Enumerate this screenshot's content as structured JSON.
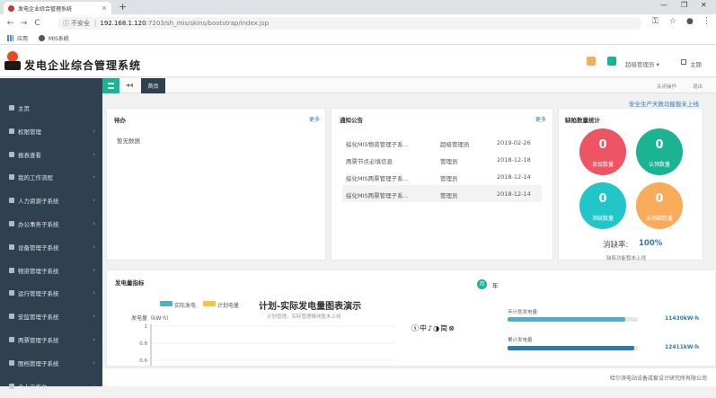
{
  "browser": {
    "tab_title": "发电企业综合管理系统",
    "tab_close": "×",
    "new_tab": "+",
    "win_min": "—",
    "win_max": "❐",
    "win_close": "✕",
    "back": "←",
    "forward": "→",
    "reload": "C",
    "info_icon": "ⓘ",
    "insecure": "不安全",
    "sep": "|",
    "url_host": "192.168.1.120",
    "url_rest": ":7203/sh_mis/skins/bootstrap/index.jsp",
    "bookmarks": [
      "应用",
      "MIS系统"
    ]
  },
  "header": {
    "title": "发电企业综合管理系统",
    "user": "超级管理员",
    "user_caret": "▾",
    "theme": "主题"
  },
  "tabs_row": {
    "back": "◂◂",
    "home": "首页",
    "close_ops": "关闭操作",
    "exit": "退出"
  },
  "notice": "安全生产天数功能暂未上线",
  "sidebar": {
    "chevron": "›",
    "items": [
      {
        "label": "主页",
        "chevron": false
      },
      {
        "label": "权限管理",
        "chevron": true
      },
      {
        "label": "报表查看",
        "chevron": true
      },
      {
        "label": "我的工作流程",
        "chevron": true
      },
      {
        "label": "人力资源子系统",
        "chevron": true
      },
      {
        "label": "办公事务子系统",
        "chevron": true
      },
      {
        "label": "设备管理子系统",
        "chevron": true
      },
      {
        "label": "物资管理子系统",
        "chevron": true
      },
      {
        "label": "运行管理子系统",
        "chevron": true
      },
      {
        "label": "安监管理子系统",
        "chevron": true
      },
      {
        "label": "两票管理子系统",
        "chevron": true
      },
      {
        "label": "图档管理子系统",
        "chevron": true
      },
      {
        "label": "个人工作台",
        "chevron": true
      }
    ]
  },
  "todo": {
    "title": "待办",
    "more": "更多",
    "empty": "暂无数据"
  },
  "announce": {
    "title": "通知公告",
    "more": "更多",
    "rows": [
      {
        "title": "绥化MIS物资管理子系...",
        "author": "超级管理员",
        "date": "2019-02-26"
      },
      {
        "title": "两票节点必填信息",
        "author": "管理员",
        "date": "2018-12-18"
      },
      {
        "title": "绥化MIS两票管理子系...",
        "author": "管理员",
        "date": "2018-12-14"
      },
      {
        "title": "绥化MIS两票管理子系...",
        "author": "管理员",
        "date": "2018-12-14"
      }
    ]
  },
  "defects": {
    "title": "缺陷数量统计",
    "items": [
      {
        "value": "0",
        "label": "发现数量",
        "color": "#ed5565"
      },
      {
        "value": "0",
        "label": "认领数量",
        "color": "#1ab394"
      },
      {
        "value": "0",
        "label": "消缺数量",
        "color": "#23c6c8"
      },
      {
        "value": "0",
        "label": "未消缺数量",
        "color": "#f8ac59"
      }
    ],
    "rate_label": "消缺率:",
    "rate_value": "100%",
    "rate_note": "缺陷功能暂未上线"
  },
  "power": {
    "title": "发电量指标",
    "legend_actual": "实际发电",
    "legend_plan": "计划电量",
    "chart_title": "计划-实际发电量图表演示",
    "chart_sub": "计划管理，实际管理模块暂未上线",
    "y_label": "发电量（kW·h）",
    "ime": "ⓢ中♪◑简⊗",
    "month_badge": "月",
    "year": "年",
    "plan_label": "年计划发电量",
    "plan_value": "11430kW·h",
    "plan_fill": 0.9,
    "actual_label": "累计发电量",
    "actual_value": "12411kW·h",
    "actual_fill": 0.97
  },
  "chart_data": {
    "type": "bar",
    "title": "计划-实际发电量图表演示",
    "ylabel": "发电量（kW·h）",
    "y_ticks": [
      "1",
      "0.8",
      "0.6"
    ],
    "series": [
      {
        "name": "实际发电",
        "values": []
      },
      {
        "name": "计划电量",
        "values": []
      }
    ]
  },
  "footer": "哈尔滨电站设备成套设计研究所有限公司",
  "colors": {
    "sidebar": "#2f4050",
    "accent": "#1ab394",
    "link": "#2a7ab8"
  }
}
